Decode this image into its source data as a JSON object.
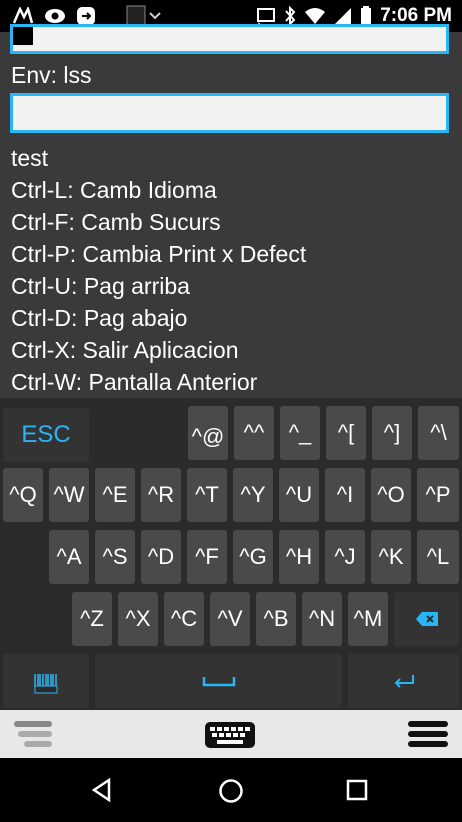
{
  "status_bar": {
    "time": "7:06 PM",
    "left_icons": [
      "motorola-icon",
      "eye-icon",
      "app-icon",
      "screenshot-icon"
    ],
    "right_icons": [
      "cast-icon",
      "bluetooth-icon",
      "wifi-icon",
      "signal-icon",
      "battery-icon"
    ]
  },
  "terminal": {
    "env_line": "Env: lss",
    "lines": [
      "test",
      "Ctrl-L: Camb Idioma",
      "Ctrl-F: Camb Sucurs",
      "Ctrl-P: Cambia Print x Defect",
      "Ctrl-U: Pag arriba",
      "Ctrl-D: Pag abajo",
      "Ctrl-X: Salir Aplicacion",
      "Ctrl-W: Pantalla Anterior"
    ],
    "accent": "#29b6f6"
  },
  "keyboard": {
    "esc_label": "ESC",
    "row1": [
      "^@",
      "^^",
      "^_",
      "^[",
      "^]",
      "^\\"
    ],
    "row2": [
      "^Q",
      "^W",
      "^E",
      "^R",
      "^T",
      "^Y",
      "^U",
      "^I",
      "^O",
      "^P"
    ],
    "row3": [
      "^A",
      "^S",
      "^D",
      "^F",
      "^G",
      "^H",
      "^J",
      "^K",
      "^L"
    ],
    "row4": [
      "^Z",
      "^X",
      "^C",
      "^V",
      "^B",
      "^N",
      "^M"
    ],
    "scan_label": "SCAN"
  }
}
